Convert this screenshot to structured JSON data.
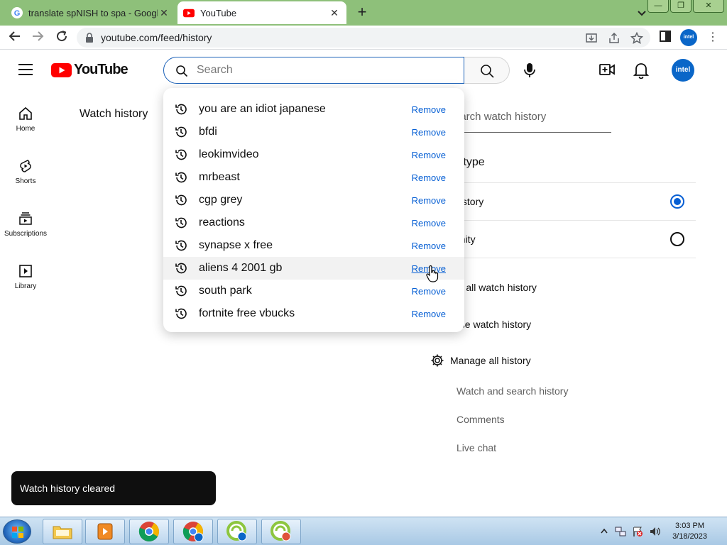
{
  "browser": {
    "tabs": [
      {
        "title": "translate spNISH to spa - Google",
        "active": false,
        "favicon": "google-icon"
      },
      {
        "title": "YouTube",
        "active": true,
        "favicon": "youtube-icon"
      }
    ],
    "url": "youtube.com/feed/history",
    "profile_label": "intel"
  },
  "youtube": {
    "logo_text": "YouTube",
    "search": {
      "placeholder": "Search",
      "value": ""
    },
    "avatar_label": "intel",
    "rail": [
      {
        "label": "Home",
        "icon": "home-icon"
      },
      {
        "label": "Shorts",
        "icon": "shorts-icon"
      },
      {
        "label": "Subscriptions",
        "icon": "subscriptions-icon"
      },
      {
        "label": "Library",
        "icon": "library-icon"
      }
    ],
    "page_title": "Watch history",
    "right_panel": {
      "search_placeholder": "earch watch history",
      "history_type_label": "y type",
      "options": [
        {
          "label": "history",
          "selected": true
        },
        {
          "label": "unity",
          "selected": false
        }
      ],
      "actions": [
        "ar all watch history",
        "use watch history"
      ],
      "manage_label": "Manage all history",
      "sub_links": [
        "Watch and search history",
        "Comments",
        "Live chat"
      ]
    },
    "suggestions": [
      {
        "query": "you are an idiot japanese",
        "remove": "Remove"
      },
      {
        "query": "bfdi",
        "remove": "Remove"
      },
      {
        "query": "leokimvideo",
        "remove": "Remove"
      },
      {
        "query": "mrbeast",
        "remove": "Remove"
      },
      {
        "query": "cgp grey",
        "remove": "Remove"
      },
      {
        "query": "reactions",
        "remove": "Remove"
      },
      {
        "query": "synapse x free",
        "remove": "Remove"
      },
      {
        "query": "aliens 4 2001 gb",
        "remove": "Remove",
        "hovered": true
      },
      {
        "query": "south park",
        "remove": "Remove"
      },
      {
        "query": "fortnite free vbucks",
        "remove": "Remove"
      }
    ],
    "toast": "Watch history cleared"
  },
  "taskbar": {
    "time": "3:03 PM",
    "date": "3/18/2023"
  },
  "colors": {
    "accent": "#065fd4",
    "youtube_red": "#ff0000",
    "tabbar_green": "#8ec07a"
  }
}
